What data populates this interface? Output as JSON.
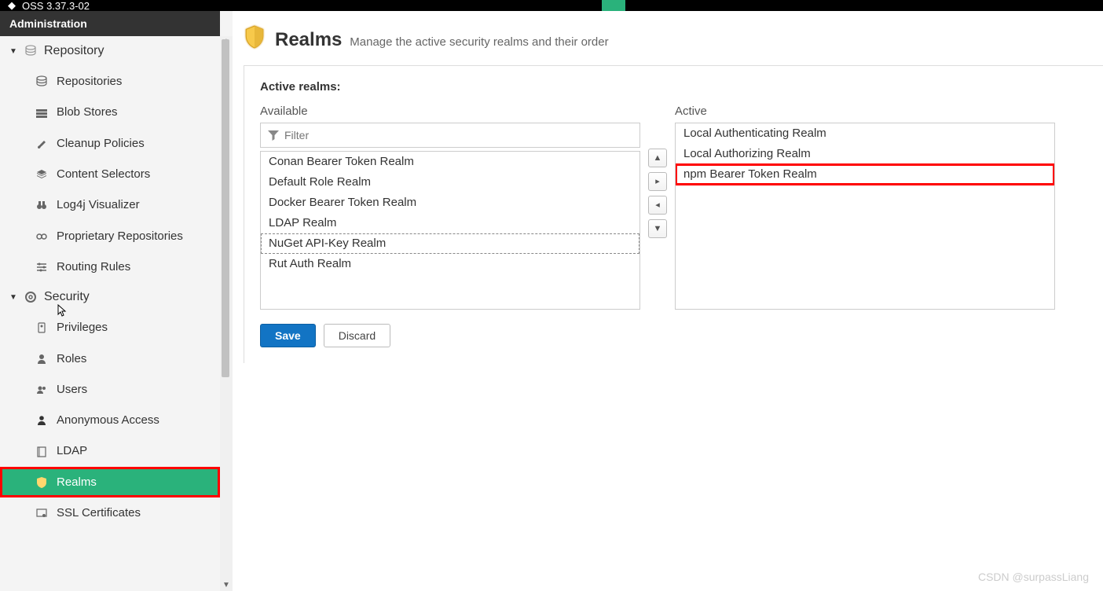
{
  "topbar": {
    "version": "OSS 3.37.3-02"
  },
  "adminHeader": "Administration",
  "sidebar": {
    "sections": [
      {
        "label": "Repository",
        "items": [
          {
            "label": "Repositories",
            "icon": "database"
          },
          {
            "label": "Blob Stores",
            "icon": "cubes"
          },
          {
            "label": "Cleanup Policies",
            "icon": "brush"
          },
          {
            "label": "Content Selectors",
            "icon": "layers"
          },
          {
            "label": "Log4j Visualizer",
            "icon": "binoculars"
          },
          {
            "label": "Proprietary Repositories",
            "icon": "link"
          },
          {
            "label": "Routing Rules",
            "icon": "sliders"
          }
        ]
      },
      {
        "label": "Security",
        "items": [
          {
            "label": "Privileges",
            "icon": "badge"
          },
          {
            "label": "Roles",
            "icon": "user-role"
          },
          {
            "label": "Users",
            "icon": "users"
          },
          {
            "label": "Anonymous Access",
            "icon": "person"
          },
          {
            "label": "LDAP",
            "icon": "book"
          },
          {
            "label": "Realms",
            "icon": "shield",
            "active": true,
            "highlighted": true
          },
          {
            "label": "SSL Certificates",
            "icon": "certificate"
          }
        ]
      }
    ]
  },
  "page": {
    "title": "Realms",
    "description": "Manage the active security realms and their order",
    "sectionTitle": "Active realms:",
    "availableLabel": "Available",
    "activeLabel": "Active",
    "filterPlaceholder": "Filter",
    "available": [
      "Conan Bearer Token Realm",
      "Default Role Realm",
      "Docker Bearer Token Realm",
      "LDAP Realm",
      "NuGet API-Key Realm",
      "Rut Auth Realm"
    ],
    "availableSelectedIndex": 4,
    "active": [
      "Local Authenticating Realm",
      "Local Authorizing Realm",
      "npm Bearer Token Realm"
    ],
    "activeHighlightedIndex": 2,
    "buttons": {
      "save": "Save",
      "discard": "Discard"
    }
  },
  "watermark": "CSDN @surpassLiang"
}
